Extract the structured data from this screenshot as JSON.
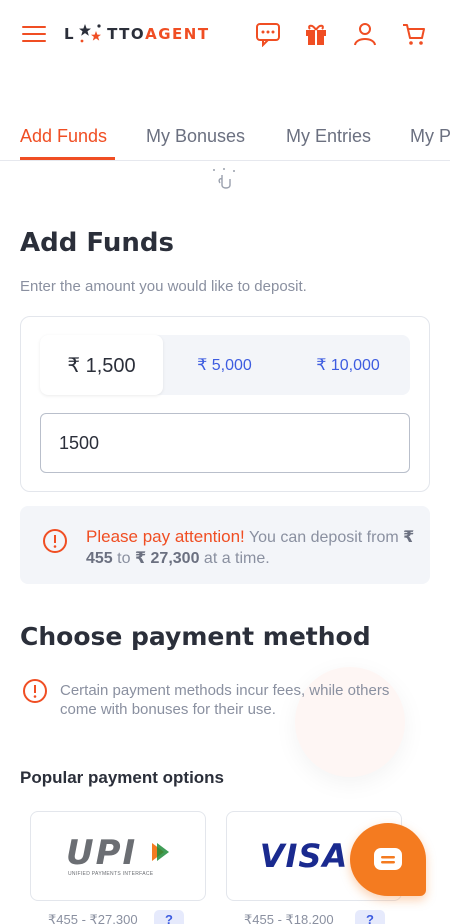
{
  "header": {
    "logo": {
      "left": "L",
      "mid": "TTO",
      "right": "AGENT"
    },
    "icons": [
      "menu-icon",
      "chat-icon",
      "gift-icon",
      "user-icon",
      "cart-icon"
    ]
  },
  "tabs": [
    {
      "label": "Add Funds",
      "active": true
    },
    {
      "label": "My Bonuses",
      "active": false
    },
    {
      "label": "My Entries",
      "active": false
    },
    {
      "label": "My P",
      "active": false
    }
  ],
  "main": {
    "title": "Add Funds",
    "subtitle": "Enter the amount you would like to deposit.",
    "presets": [
      "₹ 1,500",
      "₹ 5,000",
      "₹ 10,000"
    ],
    "selected_preset": "₹ 1,500",
    "amount_value": "1500"
  },
  "notice": {
    "heading": "Please pay attention!",
    "text_1": "You can deposit from",
    "min": "₹ 455",
    "to": "to",
    "max": "₹ 27,300",
    "text_2": "at a time."
  },
  "payment": {
    "title": "Choose payment method",
    "fee_note": "Certain payment methods incur fees, while others come with bonuses for their use.",
    "popular_title": "Popular payment options",
    "options": [
      {
        "name": "UPI",
        "subtext": "UNIFIED PAYMENTS INTERFACE",
        "limit": "₹455 - ₹27,300",
        "info": "?"
      },
      {
        "name": "VISA",
        "limit": "₹455 - ₹18,200",
        "info": "?"
      }
    ]
  },
  "colors": {
    "accent": "#f04e23",
    "link": "#3d5ce0",
    "fab": "#f47b20",
    "muted": "#8a90a0"
  }
}
